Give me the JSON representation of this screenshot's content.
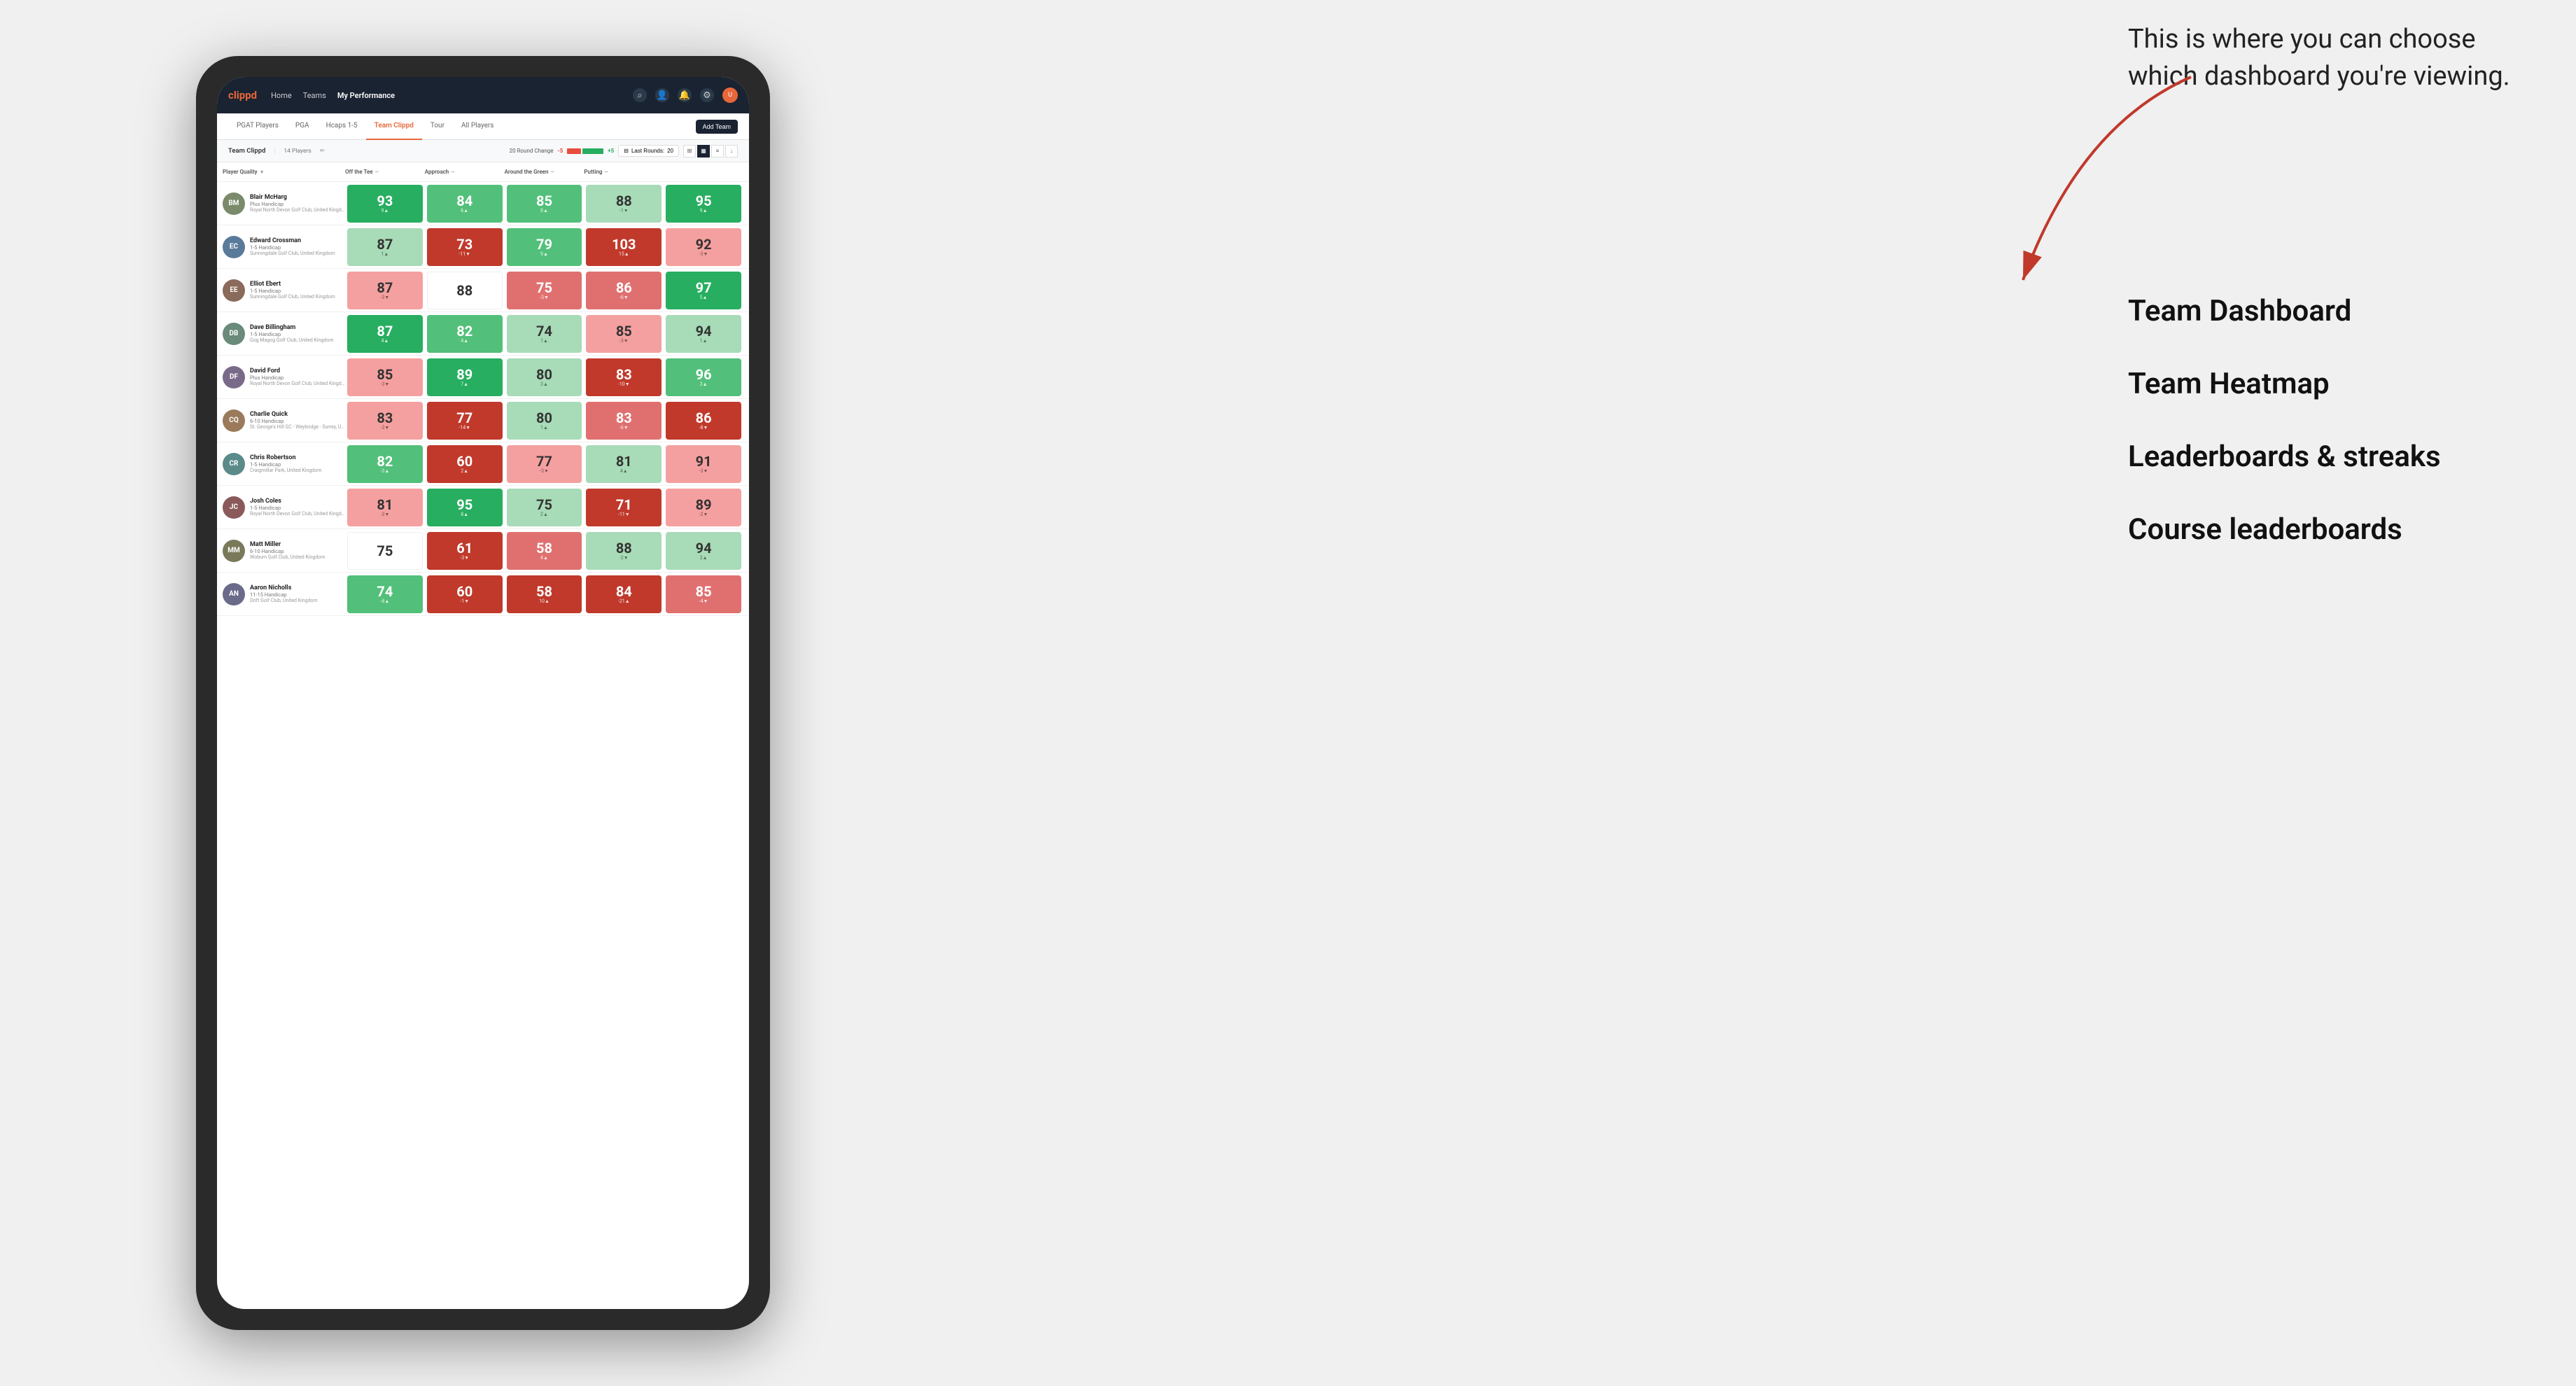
{
  "annotation": {
    "intro_text": "This is where you can choose which dashboard you're viewing.",
    "items": [
      "Team Dashboard",
      "Team Heatmap",
      "Leaderboards & streaks",
      "Course leaderboards"
    ]
  },
  "nav": {
    "logo": "clippd",
    "links": [
      {
        "label": "Home",
        "active": false
      },
      {
        "label": "Teams",
        "active": false
      },
      {
        "label": "My Performance",
        "active": true
      }
    ],
    "icons": [
      "search",
      "person",
      "bell",
      "settings",
      "avatar"
    ]
  },
  "sub_nav": {
    "tabs": [
      {
        "label": "PGAT Players",
        "active": false
      },
      {
        "label": "PGA",
        "active": false
      },
      {
        "label": "Hcaps 1-5",
        "active": false
      },
      {
        "label": "Team Clippd",
        "active": true
      },
      {
        "label": "Tour",
        "active": false
      },
      {
        "label": "All Players",
        "active": false
      }
    ],
    "add_team_label": "Add Team"
  },
  "team_bar": {
    "name": "Team Clippd",
    "separator": "|",
    "count": "14 Players",
    "round_change_label": "20 Round Change",
    "change_minus": "-5",
    "change_plus": "+5",
    "last_rounds_label": "Last Rounds:",
    "last_rounds_value": "20"
  },
  "table": {
    "columns": [
      {
        "label": "Player Quality",
        "arrow": "▼"
      },
      {
        "label": "Off the Tee",
        "arrow": "—"
      },
      {
        "label": "Approach",
        "arrow": "—"
      },
      {
        "label": "Around the Green",
        "arrow": "—"
      },
      {
        "label": "Putting",
        "arrow": "—"
      }
    ],
    "players": [
      {
        "name": "Blair McHarg",
        "handicap": "Plus Handicap",
        "club": "Royal North Devon Golf Club, United Kingdom",
        "avatar_color": "#7a8a6a",
        "initials": "BM",
        "scores": [
          {
            "value": "93",
            "change": "9▲",
            "bg": "green-strong"
          },
          {
            "value": "84",
            "change": "6▲",
            "bg": "green-mid"
          },
          {
            "value": "85",
            "change": "8▲",
            "bg": "green-mid"
          },
          {
            "value": "88",
            "change": "-1▼",
            "bg": "green-light"
          },
          {
            "value": "95",
            "change": "9▲",
            "bg": "green-strong"
          }
        ]
      },
      {
        "name": "Edward Crossman",
        "handicap": "1-5 Handicap",
        "club": "Sunningdale Golf Club, United Kingdom",
        "avatar_color": "#5a7a9a",
        "initials": "EC",
        "scores": [
          {
            "value": "87",
            "change": "1▲",
            "bg": "green-light"
          },
          {
            "value": "73",
            "change": "-11▼",
            "bg": "red-strong"
          },
          {
            "value": "79",
            "change": "9▲",
            "bg": "green-mid"
          },
          {
            "value": "103",
            "change": "15▲",
            "bg": "red-strong"
          },
          {
            "value": "92",
            "change": "-3▼",
            "bg": "red-light"
          }
        ]
      },
      {
        "name": "Elliot Ebert",
        "handicap": "1-5 Handicap",
        "club": "Sunningdale Golf Club, United Kingdom",
        "avatar_color": "#8a6a5a",
        "initials": "EE",
        "scores": [
          {
            "value": "87",
            "change": "-3▼",
            "bg": "red-light"
          },
          {
            "value": "88",
            "change": "",
            "bg": "white"
          },
          {
            "value": "75",
            "change": "-3▼",
            "bg": "red-mid"
          },
          {
            "value": "86",
            "change": "-6▼",
            "bg": "red-mid"
          },
          {
            "value": "97",
            "change": "5▲",
            "bg": "green-strong"
          }
        ]
      },
      {
        "name": "Dave Billingham",
        "handicap": "1-5 Handicap",
        "club": "Gog Magog Golf Club, United Kingdom",
        "avatar_color": "#6a8a7a",
        "initials": "DB",
        "scores": [
          {
            "value": "87",
            "change": "4▲",
            "bg": "green-strong"
          },
          {
            "value": "82",
            "change": "4▲",
            "bg": "green-mid"
          },
          {
            "value": "74",
            "change": "1▲",
            "bg": "green-light"
          },
          {
            "value": "85",
            "change": "-3▼",
            "bg": "red-light"
          },
          {
            "value": "94",
            "change": "1▲",
            "bg": "green-light"
          }
        ]
      },
      {
        "name": "David Ford",
        "handicap": "Plus Handicap",
        "club": "Royal North Devon Golf Club, United Kingdom",
        "avatar_color": "#7a6a8a",
        "initials": "DF",
        "scores": [
          {
            "value": "85",
            "change": "-3▼",
            "bg": "red-light"
          },
          {
            "value": "89",
            "change": "7▲",
            "bg": "green-strong"
          },
          {
            "value": "80",
            "change": "3▲",
            "bg": "green-light"
          },
          {
            "value": "83",
            "change": "-10▼",
            "bg": "red-strong"
          },
          {
            "value": "96",
            "change": "3▲",
            "bg": "green-mid"
          }
        ]
      },
      {
        "name": "Charlie Quick",
        "handicap": "6-10 Handicap",
        "club": "St. George's Hill GC - Weybridge - Surrey, Uni...",
        "avatar_color": "#9a7a5a",
        "initials": "CQ",
        "scores": [
          {
            "value": "83",
            "change": "-3▼",
            "bg": "red-light"
          },
          {
            "value": "77",
            "change": "-14▼",
            "bg": "red-strong"
          },
          {
            "value": "80",
            "change": "1▲",
            "bg": "green-light"
          },
          {
            "value": "83",
            "change": "-6▼",
            "bg": "red-mid"
          },
          {
            "value": "86",
            "change": "-8▼",
            "bg": "red-strong"
          }
        ]
      },
      {
        "name": "Chris Robertson",
        "handicap": "1-5 Handicap",
        "club": "Craigmillar Park, United Kingdom",
        "avatar_color": "#5a8a8a",
        "initials": "CR",
        "scores": [
          {
            "value": "82",
            "change": "-3▲",
            "bg": "green-mid"
          },
          {
            "value": "60",
            "change": "2▲",
            "bg": "red-strong"
          },
          {
            "value": "77",
            "change": "-3▼",
            "bg": "red-light"
          },
          {
            "value": "81",
            "change": "4▲",
            "bg": "green-light"
          },
          {
            "value": "91",
            "change": "-3▼",
            "bg": "red-light"
          }
        ]
      },
      {
        "name": "Josh Coles",
        "handicap": "1-5 Handicap",
        "club": "Royal North Devon Golf Club, United Kingdom",
        "avatar_color": "#8a5a5a",
        "initials": "JC",
        "scores": [
          {
            "value": "81",
            "change": "-3▼",
            "bg": "red-light"
          },
          {
            "value": "95",
            "change": "8▲",
            "bg": "green-strong"
          },
          {
            "value": "75",
            "change": "2▲",
            "bg": "green-light"
          },
          {
            "value": "71",
            "change": "-11▼",
            "bg": "red-strong"
          },
          {
            "value": "89",
            "change": "-2▼",
            "bg": "red-light"
          }
        ]
      },
      {
        "name": "Matt Miller",
        "handicap": "6-10 Handicap",
        "club": "Woburn Golf Club, United Kingdom",
        "avatar_color": "#7a7a5a",
        "initials": "MM",
        "scores": [
          {
            "value": "75",
            "change": "",
            "bg": "white"
          },
          {
            "value": "61",
            "change": "-3▼",
            "bg": "red-strong"
          },
          {
            "value": "58",
            "change": "4▲",
            "bg": "red-mid"
          },
          {
            "value": "88",
            "change": "-2▼",
            "bg": "green-light"
          },
          {
            "value": "94",
            "change": "3▲",
            "bg": "green-light"
          }
        ]
      },
      {
        "name": "Aaron Nicholls",
        "handicap": "11-15 Handicap",
        "club": "Drift Golf Club, United Kingdom",
        "avatar_color": "#6a6a8a",
        "initials": "AN",
        "scores": [
          {
            "value": "74",
            "change": "-8▲",
            "bg": "green-mid"
          },
          {
            "value": "60",
            "change": "-1▼",
            "bg": "red-strong"
          },
          {
            "value": "58",
            "change": "10▲",
            "bg": "red-strong"
          },
          {
            "value": "84",
            "change": "-21▲",
            "bg": "red-strong"
          },
          {
            "value": "85",
            "change": "-4▼",
            "bg": "red-mid"
          }
        ]
      }
    ]
  }
}
